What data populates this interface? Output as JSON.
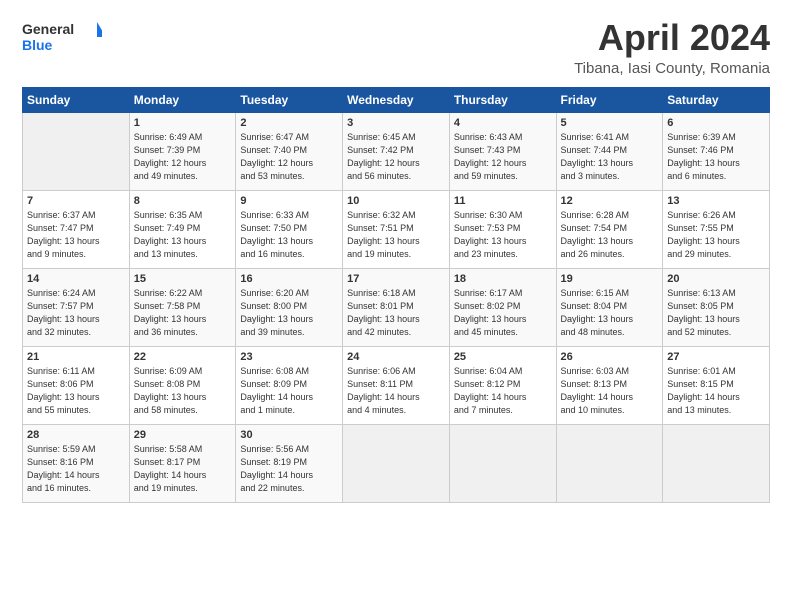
{
  "header": {
    "logo_general": "General",
    "logo_blue": "Blue",
    "title": "April 2024",
    "location": "Tibana, Iasi County, Romania"
  },
  "days_of_week": [
    "Sunday",
    "Monday",
    "Tuesday",
    "Wednesday",
    "Thursday",
    "Friday",
    "Saturday"
  ],
  "weeks": [
    [
      {
        "day": "",
        "text": ""
      },
      {
        "day": "1",
        "text": "Sunrise: 6:49 AM\nSunset: 7:39 PM\nDaylight: 12 hours\nand 49 minutes."
      },
      {
        "day": "2",
        "text": "Sunrise: 6:47 AM\nSunset: 7:40 PM\nDaylight: 12 hours\nand 53 minutes."
      },
      {
        "day": "3",
        "text": "Sunrise: 6:45 AM\nSunset: 7:42 PM\nDaylight: 12 hours\nand 56 minutes."
      },
      {
        "day": "4",
        "text": "Sunrise: 6:43 AM\nSunset: 7:43 PM\nDaylight: 12 hours\nand 59 minutes."
      },
      {
        "day": "5",
        "text": "Sunrise: 6:41 AM\nSunset: 7:44 PM\nDaylight: 13 hours\nand 3 minutes."
      },
      {
        "day": "6",
        "text": "Sunrise: 6:39 AM\nSunset: 7:46 PM\nDaylight: 13 hours\nand 6 minutes."
      }
    ],
    [
      {
        "day": "7",
        "text": "Sunrise: 6:37 AM\nSunset: 7:47 PM\nDaylight: 13 hours\nand 9 minutes."
      },
      {
        "day": "8",
        "text": "Sunrise: 6:35 AM\nSunset: 7:49 PM\nDaylight: 13 hours\nand 13 minutes."
      },
      {
        "day": "9",
        "text": "Sunrise: 6:33 AM\nSunset: 7:50 PM\nDaylight: 13 hours\nand 16 minutes."
      },
      {
        "day": "10",
        "text": "Sunrise: 6:32 AM\nSunset: 7:51 PM\nDaylight: 13 hours\nand 19 minutes."
      },
      {
        "day": "11",
        "text": "Sunrise: 6:30 AM\nSunset: 7:53 PM\nDaylight: 13 hours\nand 23 minutes."
      },
      {
        "day": "12",
        "text": "Sunrise: 6:28 AM\nSunset: 7:54 PM\nDaylight: 13 hours\nand 26 minutes."
      },
      {
        "day": "13",
        "text": "Sunrise: 6:26 AM\nSunset: 7:55 PM\nDaylight: 13 hours\nand 29 minutes."
      }
    ],
    [
      {
        "day": "14",
        "text": "Sunrise: 6:24 AM\nSunset: 7:57 PM\nDaylight: 13 hours\nand 32 minutes."
      },
      {
        "day": "15",
        "text": "Sunrise: 6:22 AM\nSunset: 7:58 PM\nDaylight: 13 hours\nand 36 minutes."
      },
      {
        "day": "16",
        "text": "Sunrise: 6:20 AM\nSunset: 8:00 PM\nDaylight: 13 hours\nand 39 minutes."
      },
      {
        "day": "17",
        "text": "Sunrise: 6:18 AM\nSunset: 8:01 PM\nDaylight: 13 hours\nand 42 minutes."
      },
      {
        "day": "18",
        "text": "Sunrise: 6:17 AM\nSunset: 8:02 PM\nDaylight: 13 hours\nand 45 minutes."
      },
      {
        "day": "19",
        "text": "Sunrise: 6:15 AM\nSunset: 8:04 PM\nDaylight: 13 hours\nand 48 minutes."
      },
      {
        "day": "20",
        "text": "Sunrise: 6:13 AM\nSunset: 8:05 PM\nDaylight: 13 hours\nand 52 minutes."
      }
    ],
    [
      {
        "day": "21",
        "text": "Sunrise: 6:11 AM\nSunset: 8:06 PM\nDaylight: 13 hours\nand 55 minutes."
      },
      {
        "day": "22",
        "text": "Sunrise: 6:09 AM\nSunset: 8:08 PM\nDaylight: 13 hours\nand 58 minutes."
      },
      {
        "day": "23",
        "text": "Sunrise: 6:08 AM\nSunset: 8:09 PM\nDaylight: 14 hours\nand 1 minute."
      },
      {
        "day": "24",
        "text": "Sunrise: 6:06 AM\nSunset: 8:11 PM\nDaylight: 14 hours\nand 4 minutes."
      },
      {
        "day": "25",
        "text": "Sunrise: 6:04 AM\nSunset: 8:12 PM\nDaylight: 14 hours\nand 7 minutes."
      },
      {
        "day": "26",
        "text": "Sunrise: 6:03 AM\nSunset: 8:13 PM\nDaylight: 14 hours\nand 10 minutes."
      },
      {
        "day": "27",
        "text": "Sunrise: 6:01 AM\nSunset: 8:15 PM\nDaylight: 14 hours\nand 13 minutes."
      }
    ],
    [
      {
        "day": "28",
        "text": "Sunrise: 5:59 AM\nSunset: 8:16 PM\nDaylight: 14 hours\nand 16 minutes."
      },
      {
        "day": "29",
        "text": "Sunrise: 5:58 AM\nSunset: 8:17 PM\nDaylight: 14 hours\nand 19 minutes."
      },
      {
        "day": "30",
        "text": "Sunrise: 5:56 AM\nSunset: 8:19 PM\nDaylight: 14 hours\nand 22 minutes."
      },
      {
        "day": "",
        "text": ""
      },
      {
        "day": "",
        "text": ""
      },
      {
        "day": "",
        "text": ""
      },
      {
        "day": "",
        "text": ""
      }
    ]
  ]
}
